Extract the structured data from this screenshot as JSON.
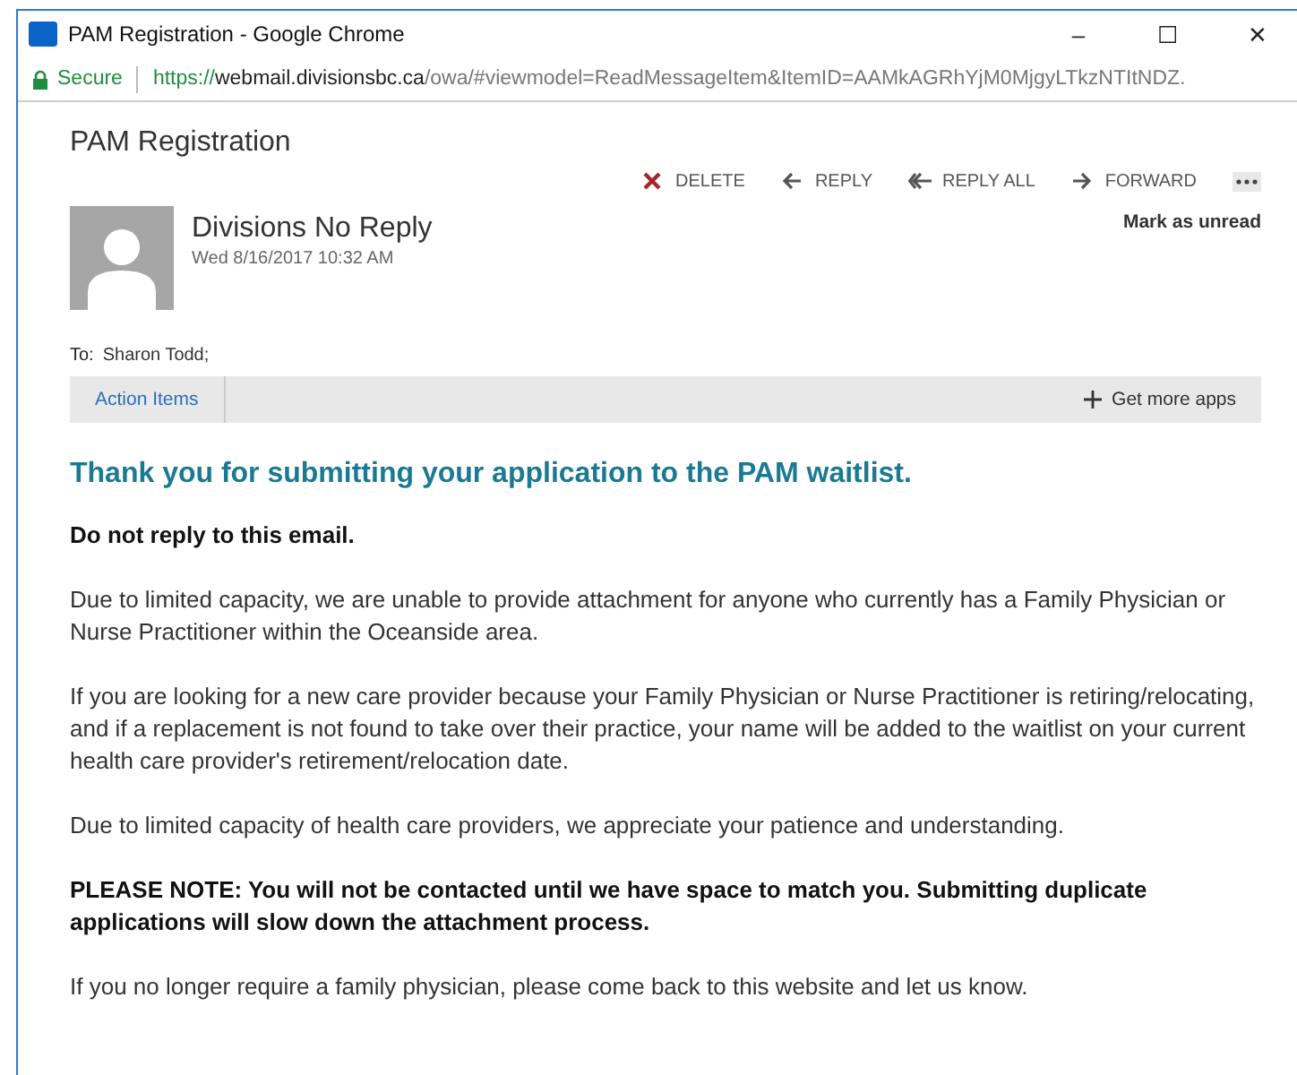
{
  "window": {
    "title": "PAM Registration - Google Chrome",
    "controls": [
      "–",
      "☐",
      "✕"
    ]
  },
  "address_bar": {
    "secure_label": "Secure",
    "scheme": "https://",
    "host": "webmail.divisionsbc.ca",
    "path": "/owa/#viewmodel=ReadMessageItem&ItemID=AAMkAGRhYjM0MjgyLTkzNTItNDZ."
  },
  "message": {
    "subject": "PAM Registration",
    "actions": [
      {
        "kind": "delete",
        "label": "DELETE"
      },
      {
        "kind": "reply",
        "label": "REPLY"
      },
      {
        "kind": "reply_all",
        "label": "REPLY ALL"
      },
      {
        "kind": "forward",
        "label": "FORWARD"
      }
    ],
    "sender": "Divisions No Reply",
    "date": "Wed 8/16/2017 10:32 AM",
    "mark_unread": "Mark as unread",
    "to_label": "To:",
    "to": "Sharon Todd;",
    "apps_bar": {
      "item": "Action Items",
      "get_more": "Get more apps"
    },
    "heading": "Thank you for submitting your application to the PAM waitlist.",
    "paragraphs": [
      {
        "kind": "bold",
        "text": "Do not reply to this email."
      },
      {
        "kind": "plain",
        "text": "Due to limited capacity, we are unable to provide attachment for anyone who currently has a Family Physician or Nurse Practitioner within the Oceanside area."
      },
      {
        "kind": "plain",
        "text": "If you are looking for a new care provider because your Family Physician or Nurse Practitioner is retiring/relocating, and if a replacement is not found to take over their practice, your name will be added to the waitlist on your current health care provider's retirement/relocation date."
      },
      {
        "kind": "plain",
        "text": "Due to limited capacity of health care providers, we appreciate your patience and understanding."
      },
      {
        "kind": "bold",
        "text": "PLEASE NOTE: You will not be contacted until we have space to match you. Submitting duplicate applications will slow down the attachment process."
      },
      {
        "kind": "plain",
        "text": "If you no longer require a family physician, please come back to this website and let us know."
      }
    ]
  }
}
